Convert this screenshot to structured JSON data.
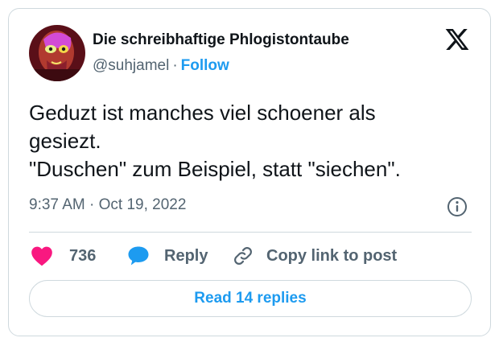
{
  "author": {
    "display_name": "Die schreibhaftige Phlogistontaube",
    "handle": "@suhjamel",
    "separator": "·",
    "follow_label": "Follow"
  },
  "tweet": {
    "lines": [
      "Geduzt ist manches viel schoener als",
      "gesiezt.",
      "\"Duschen\" zum Beispiel, statt \"siechen\"."
    ],
    "time": "9:37 AM",
    "separator": "·",
    "date": "Oct 19, 2022"
  },
  "actions": {
    "like_count": "736",
    "reply_label": "Reply",
    "copy_label": "Copy link to post"
  },
  "read_replies_label": "Read 14 replies",
  "colors": {
    "accent": "#1d9bf0",
    "like": "#f91880",
    "text": "#0f1419",
    "muted": "#536471",
    "border": "#cfd9de"
  },
  "icons": [
    "x-logo-icon",
    "info-icon",
    "heart-icon",
    "reply-bubble-icon",
    "link-icon"
  ]
}
